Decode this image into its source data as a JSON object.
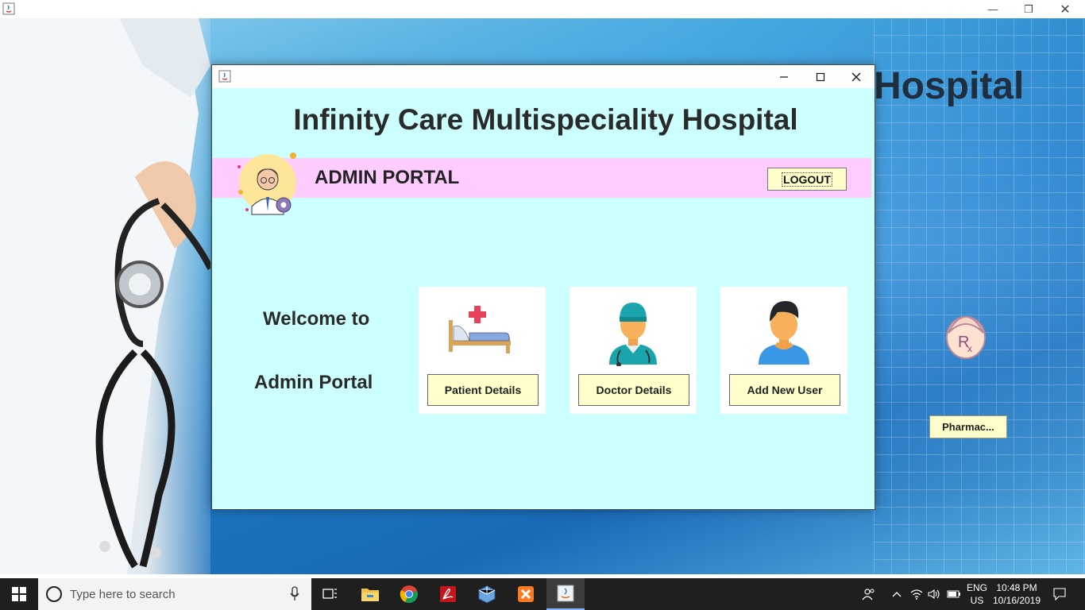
{
  "background": {
    "title_fragment": "Hospital",
    "pharmacy_button": "Pharmac...",
    "window_controls": [
      "minimize-icon",
      "restore-icon",
      "close-icon"
    ]
  },
  "dialog": {
    "hospital_title": "Infinity Care Multispeciality Hospital",
    "portal_label": "ADMIN PORTAL",
    "logout_label": "LOGOUT",
    "welcome_line1": "Welcome to",
    "welcome_line2": "Admin Portal",
    "cards": [
      {
        "icon": "hospital-bed-icon",
        "label": "Patient Details"
      },
      {
        "icon": "doctor-icon",
        "label": "Doctor Details"
      },
      {
        "icon": "user-icon",
        "label": "Add New User"
      }
    ],
    "colors": {
      "background": "#ccffff",
      "banner": "#ffccff",
      "button": "#ffffcc"
    }
  },
  "taskbar": {
    "search_placeholder": "Type here to search",
    "lang_line1": "ENG",
    "lang_line2": "US",
    "time": "10:48 PM",
    "date": "10/16/2019",
    "apps": [
      "task-view-icon",
      "file-explorer-icon",
      "chrome-icon",
      "acrobat-icon",
      "virtualbox-icon",
      "xampp-icon",
      "java-icon"
    ]
  }
}
